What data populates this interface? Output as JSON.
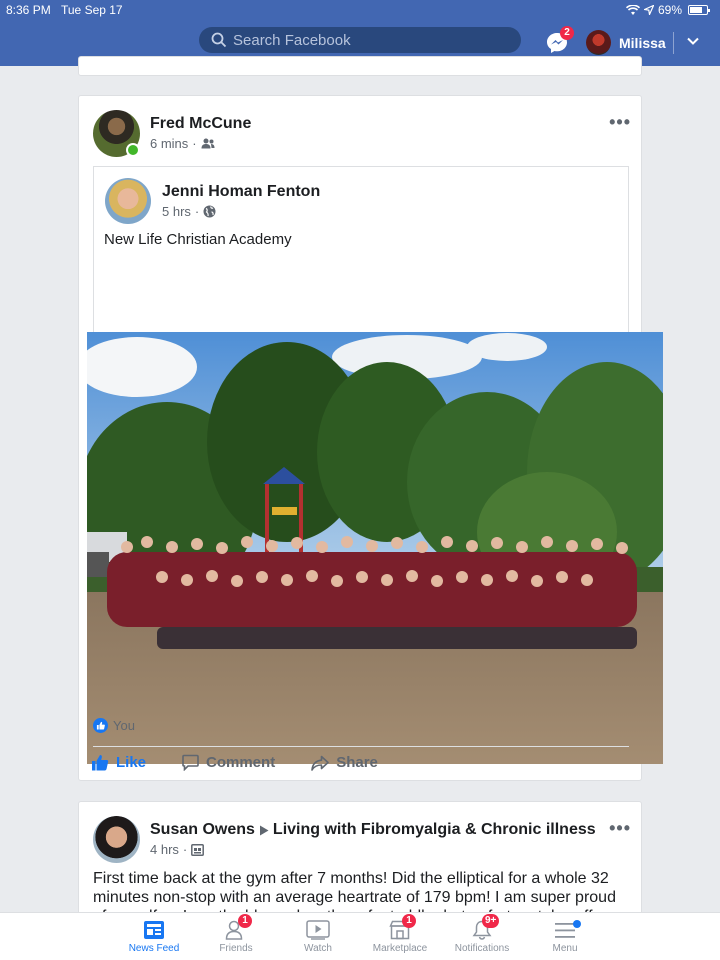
{
  "status_bar": {
    "time": "8:36 PM",
    "date": "Tue Sep 17",
    "battery": "69%"
  },
  "header": {
    "search_placeholder": "Search Facebook",
    "messenger_badge": "2",
    "profile_name": "Milissa"
  },
  "post": {
    "author": "Fred McCune",
    "time": "6 mins",
    "audience_icon": "friends-icon",
    "shared": {
      "author": "Jenni Homan Fenton",
      "time": "5 hrs",
      "audience_icon": "globe-icon",
      "text": "New Life Christian Academy"
    },
    "reactions_text": "You",
    "actions": {
      "like": "Like",
      "comment": "Comment",
      "share": "Share"
    }
  },
  "next_post": {
    "author": "Susan Owens",
    "group": "Living with Fibromyalgia & Chronic illness",
    "time": "4 hrs",
    "text": "First time back at the gym after 7 months! Did the elliptical for a whole 32 minutes non-stop with an average heartrate of 179 bpm! I am super proud of myself as I am the blessed mother of a toddler but unfortunately suffer"
  },
  "bottom_nav": {
    "items": [
      {
        "label": "News Feed",
        "icon": "news-feed-icon",
        "active": true
      },
      {
        "label": "Friends",
        "icon": "friends-icon",
        "badge": "1"
      },
      {
        "label": "Watch",
        "icon": "watch-icon"
      },
      {
        "label": "Marketplace",
        "icon": "marketplace-icon",
        "badge": "1"
      },
      {
        "label": "Notifications",
        "icon": "bell-icon",
        "badge": "9+"
      },
      {
        "label": "Menu",
        "icon": "menu-icon"
      }
    ]
  },
  "colors": {
    "brand": "#4267b2",
    "accent": "#1877f2",
    "badge": "#f02849",
    "online": "#42b72a"
  }
}
